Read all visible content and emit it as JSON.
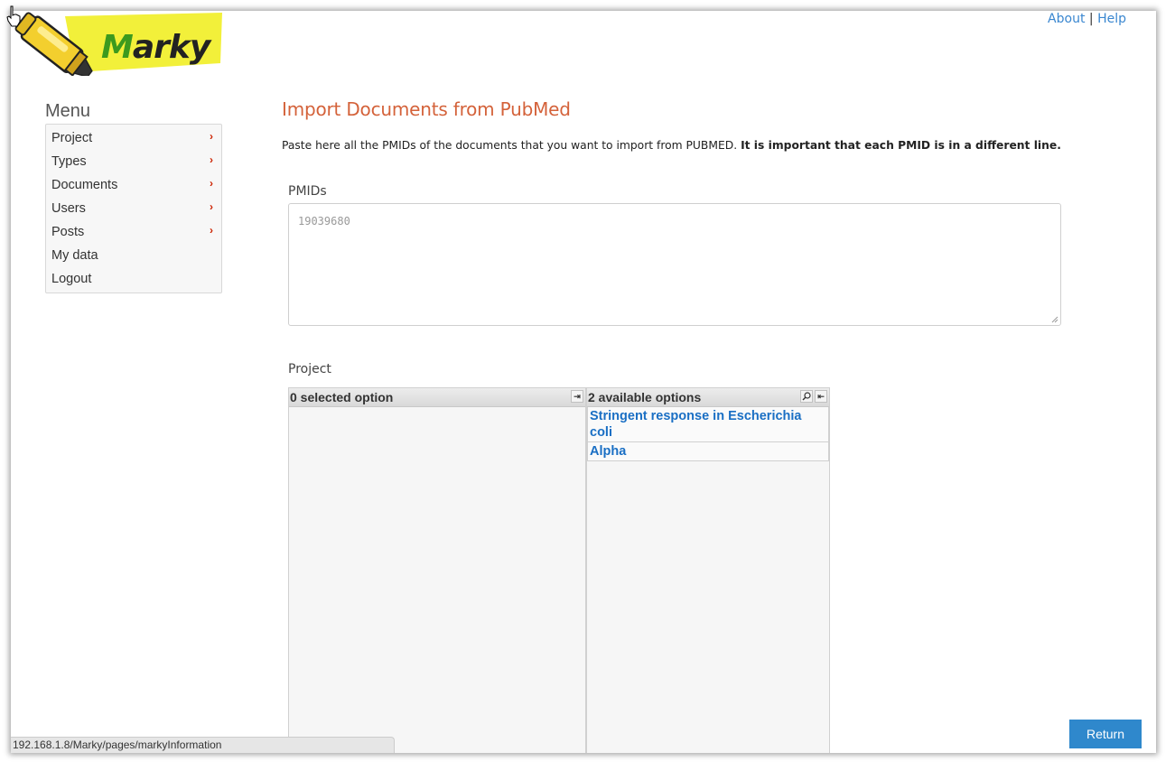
{
  "app": {
    "logo_text": "Marky",
    "colors": {
      "logo_yellow": "#f2f03a",
      "logo_green": "#3c9a1e",
      "title_accent": "#d4623a",
      "link": "#3a87d0",
      "option_link": "#1a6fc4",
      "button": "#2f88cc",
      "chevron": "#cc2200"
    }
  },
  "toplinks": {
    "about": "About",
    "separator": "|",
    "help": "Help"
  },
  "menu": {
    "title": "Menu",
    "items": [
      {
        "label": "Project",
        "has_submenu": true
      },
      {
        "label": "Types",
        "has_submenu": true
      },
      {
        "label": "Documents",
        "has_submenu": true
      },
      {
        "label": "Users",
        "has_submenu": true
      },
      {
        "label": "Posts",
        "has_submenu": true
      },
      {
        "label": "My data",
        "has_submenu": false
      },
      {
        "label": "Logout",
        "has_submenu": false
      }
    ],
    "chevron_glyph": "›"
  },
  "main": {
    "title": "Import Documents from PubMed",
    "instructions_normal": "Paste here all the PMIDs of the documents that you want to import from PUBMED.",
    "instructions_bold": "It is important that each PMID is in a different line.",
    "pmids_label": "PMIDs",
    "pmids_placeholder": "19039680",
    "project_label": "Project",
    "multiselect": {
      "selected_header": "0 selected option",
      "available_header": "2 available options",
      "available_options": [
        "Stringent response in Escherichia coli",
        "Alpha"
      ],
      "icons": {
        "add_all": "add-all-icon",
        "search": "search-icon",
        "remove_all": "remove-all-icon"
      }
    }
  },
  "footer": {
    "return_label": "Return"
  },
  "statusbar": {
    "url": "192.168.1.8/Marky/pages/markyInformation"
  }
}
